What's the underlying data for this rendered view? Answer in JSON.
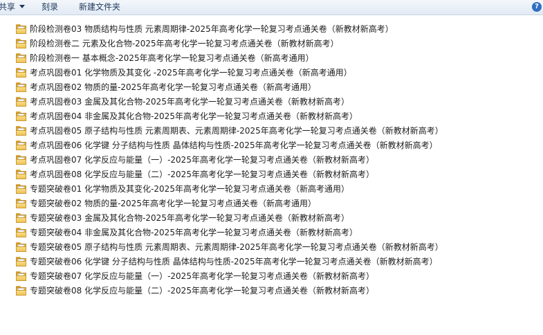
{
  "toolbar": {
    "share_label": "共享",
    "burn_label": "刻录",
    "new_folder_label": "新建文件夹",
    "help_glyph": "?"
  },
  "files": [
    {
      "name": "阶段检测卷03  物质结构与性质 元素周期律-2025年高考化学一轮复习考点通关卷（新教材新高考）"
    },
    {
      "name": "阶段检测卷二  元素及化合物-2025年高考化学一轮复习考点通关卷（新教材新高考）"
    },
    {
      "name": "阶段检测卷一 基本概念-2025年高考化学一轮复习考点通关卷（新高考通用）"
    },
    {
      "name": "考点巩固卷01 化学物质及其变化 -2025年高考化学一轮复习考点通关卷（新高考通用）"
    },
    {
      "name": "考点巩固卷02  物质的量-2025年高考化学一轮复习考点通关卷（新高考通用）"
    },
    {
      "name": "考点巩固卷03  金属及其化合物-2025年高考化学一轮复习考点通关卷（新教材新高考）"
    },
    {
      "name": "考点巩固卷04  非金属及其化合物-2025年高考化学一轮复习考点通关卷（新教材新高考）"
    },
    {
      "name": "考点巩固卷05  原子结构与性质  元素周期表、元素周期律-2025年高考化学一轮复习考点通关卷（新教材新高考）"
    },
    {
      "name": "考点巩固卷06  化学键  分子结构与性质  晶体结构与性质-2025年高考化学一轮复习考点通关卷（新教材新高考）"
    },
    {
      "name": "考点巩固卷07 化学反应与能量（一）-2025年高考化学一轮复习考点通关卷（新教材新高考）"
    },
    {
      "name": "考点巩固卷08 化学反应与能量（二）-2025年高考化学一轮复习考点通关卷（新教材新高考）"
    },
    {
      "name": "专题突破卷01 化学物质及其变化-2025年高考化学一轮复习考点通关卷（新高考通用）"
    },
    {
      "name": "专题突破卷02 物质的量-2025年高考化学一轮复习考点通关卷（新高考通用）"
    },
    {
      "name": "专题突破卷03  金属及其化合物-2025年高考化学一轮复习考点通关卷（新教材新高考）"
    },
    {
      "name": "专题突破卷04  非金属及其化合物-2025年高考化学一轮复习考点通关卷（新教材新高考）"
    },
    {
      "name": "专题突破卷05  原子结构与性质  元素周期表、元素周期律-2025年高考化学一轮复习考点通关卷（新教材新高考）"
    },
    {
      "name": "专题突破卷06  化学键  分子结构与性质  晶体结构与性质-2025年高考化学一轮复习考点通关卷（新教材新高考）"
    },
    {
      "name": "专题突破卷07 化学反应与能量（一）-2025年高考化学一轮复习考点通关卷（新教材新高考）"
    },
    {
      "name": "专题突破卷08 化学反应与能量（二）-2025年高考化学一轮复习考点通关卷（新教材新高考）"
    }
  ]
}
